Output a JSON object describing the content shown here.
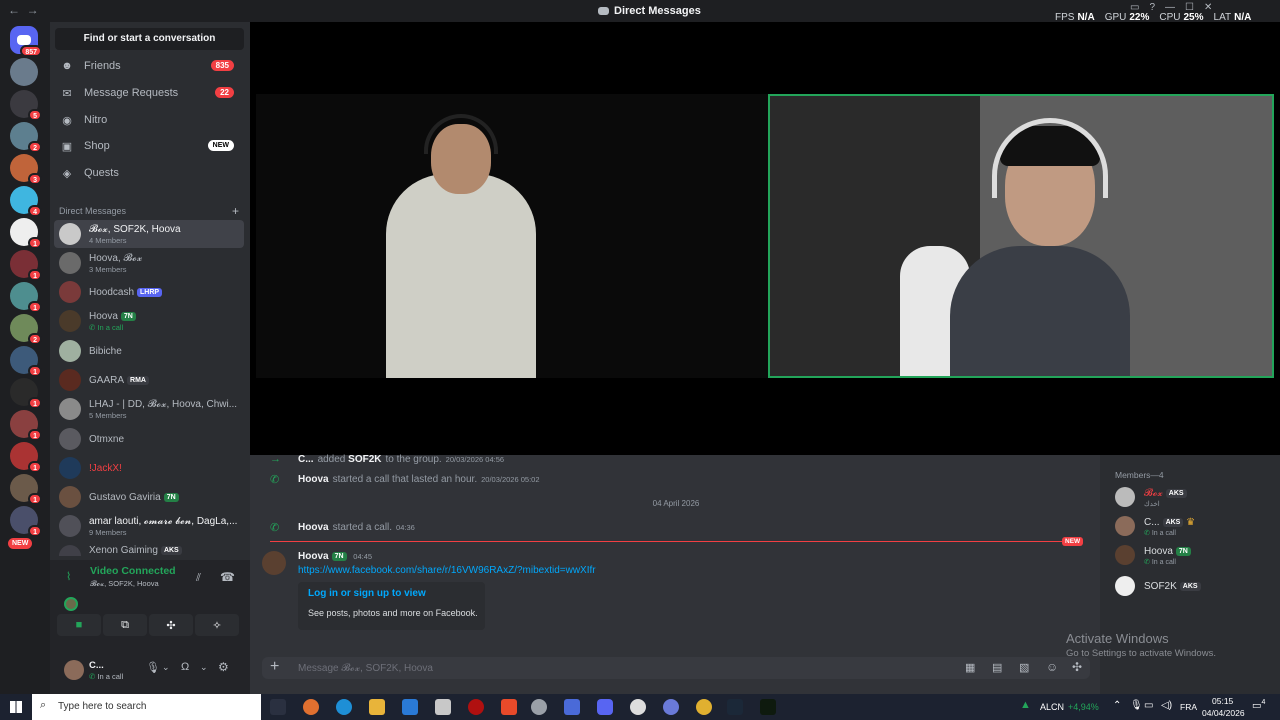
{
  "window": {
    "title": "Direct Messages",
    "nav_back": "←",
    "nav_fwd": "→"
  },
  "stats": {
    "fps_label": "FPS",
    "fps": "N/A",
    "gpu_label": "GPU",
    "gpu": "22%",
    "cpu_label": "CPU",
    "cpu": "25%",
    "lat_label": "LAT",
    "lat": "N/A"
  },
  "rail": {
    "home_badge": "857",
    "badges": [
      "5",
      "2",
      "3",
      "4",
      "1",
      "1",
      "1",
      "2",
      "1",
      "1",
      "1",
      "1",
      "1",
      "1",
      "2",
      "1"
    ],
    "new_label": "NEW"
  },
  "sidebar": {
    "find": "Find or start a conversation",
    "nav": [
      {
        "label": "Friends",
        "icon": "friends-icon",
        "count": "835"
      },
      {
        "label": "Message Requests",
        "icon": "mail-icon",
        "count": "22"
      },
      {
        "label": "Nitro",
        "icon": "nitro-icon"
      },
      {
        "label": "Shop",
        "icon": "shop-icon",
        "badge": "NEW"
      },
      {
        "label": "Quests",
        "icon": "quests-icon"
      }
    ],
    "dm_header": "Direct Messages",
    "dms": [
      {
        "name": "𝓑𝓸𝔁, SOF2K, Hoova",
        "sub": "4 Members"
      },
      {
        "name": "Hoova, 𝓑𝓸𝔁",
        "sub": "3 Members"
      },
      {
        "name": "Hoodcash",
        "tag": "LHRP"
      },
      {
        "name": "Hoova",
        "tag": "7N",
        "sub": "In a call"
      },
      {
        "name": "Bibiche"
      },
      {
        "name": "GAARA",
        "tag": "RMA"
      },
      {
        "name": "LHAJ - | DD, 𝓑𝓸𝔁, Hoova, Chwi...",
        "sub": "5 Members"
      },
      {
        "name": "Otmxne"
      },
      {
        "name": "!JackX!"
      },
      {
        "name": "Gustavo Gaviria",
        "tag": "7N"
      },
      {
        "name": "amar laouti, 𝓸𝓶𝓪𝓻𝓮 𝓫𝓮𝓷, DagLa,...",
        "sub": "9 Members"
      },
      {
        "name": "Xenon Gaiming",
        "tag": "AKS"
      }
    ]
  },
  "voice": {
    "status": "Video Connected",
    "channel": "𝓑𝓸𝔁, SOF2K, Hoova"
  },
  "user": {
    "name": "C...",
    "status": "In a call"
  },
  "chat": {
    "m1": {
      "user": "C...",
      "text": "added",
      "target": "SOF2K",
      "tail": "to the group.",
      "ts": "20/03/2026 04:56"
    },
    "m2": {
      "user": "Hoova",
      "text": "started a call that lasted an hour.",
      "ts": "20/03/2026 05:02"
    },
    "date": "04 April 2026",
    "m3": {
      "user": "Hoova",
      "text": "started a call.",
      "ts": "04:36"
    },
    "new_label": "NEW",
    "m4": {
      "user": "Hoova",
      "tag": "7N",
      "ts": "04:45",
      "link": "https://www.facebook.com/share/r/16VW96RAxZ/?mibextid=wwXIfr"
    },
    "embed": {
      "title": "Log in or sign up to view",
      "desc": "See posts, photos and more on Facebook."
    },
    "placeholder": "Message 𝓑𝓸𝔁, SOF2K, Hoova"
  },
  "members": {
    "header": "Members—4",
    "list": [
      {
        "name": "𝓑𝓸𝔁",
        "tag": "AKS",
        "sub": "اخدك"
      },
      {
        "name": "C...",
        "tag": "AKS",
        "sub": "In a call"
      },
      {
        "name": "Hoova",
        "tag": "7N",
        "sub": "In a call"
      },
      {
        "name": "SOF2K",
        "tag": "AKS"
      }
    ]
  },
  "watermark": {
    "title": "Activate Windows",
    "sub": "Go to Settings to activate Windows."
  },
  "taskbar": {
    "search": "Type here to search",
    "stock": "ALCN",
    "stock_change": "+4,94%",
    "lang": "FRA",
    "time": "05:15",
    "date": "04/04/2026",
    "notif": "4"
  },
  "colors": {
    "accent": "#5865f2",
    "online": "#23a55a",
    "danger": "#f23f43",
    "link": "#00a8fc"
  }
}
